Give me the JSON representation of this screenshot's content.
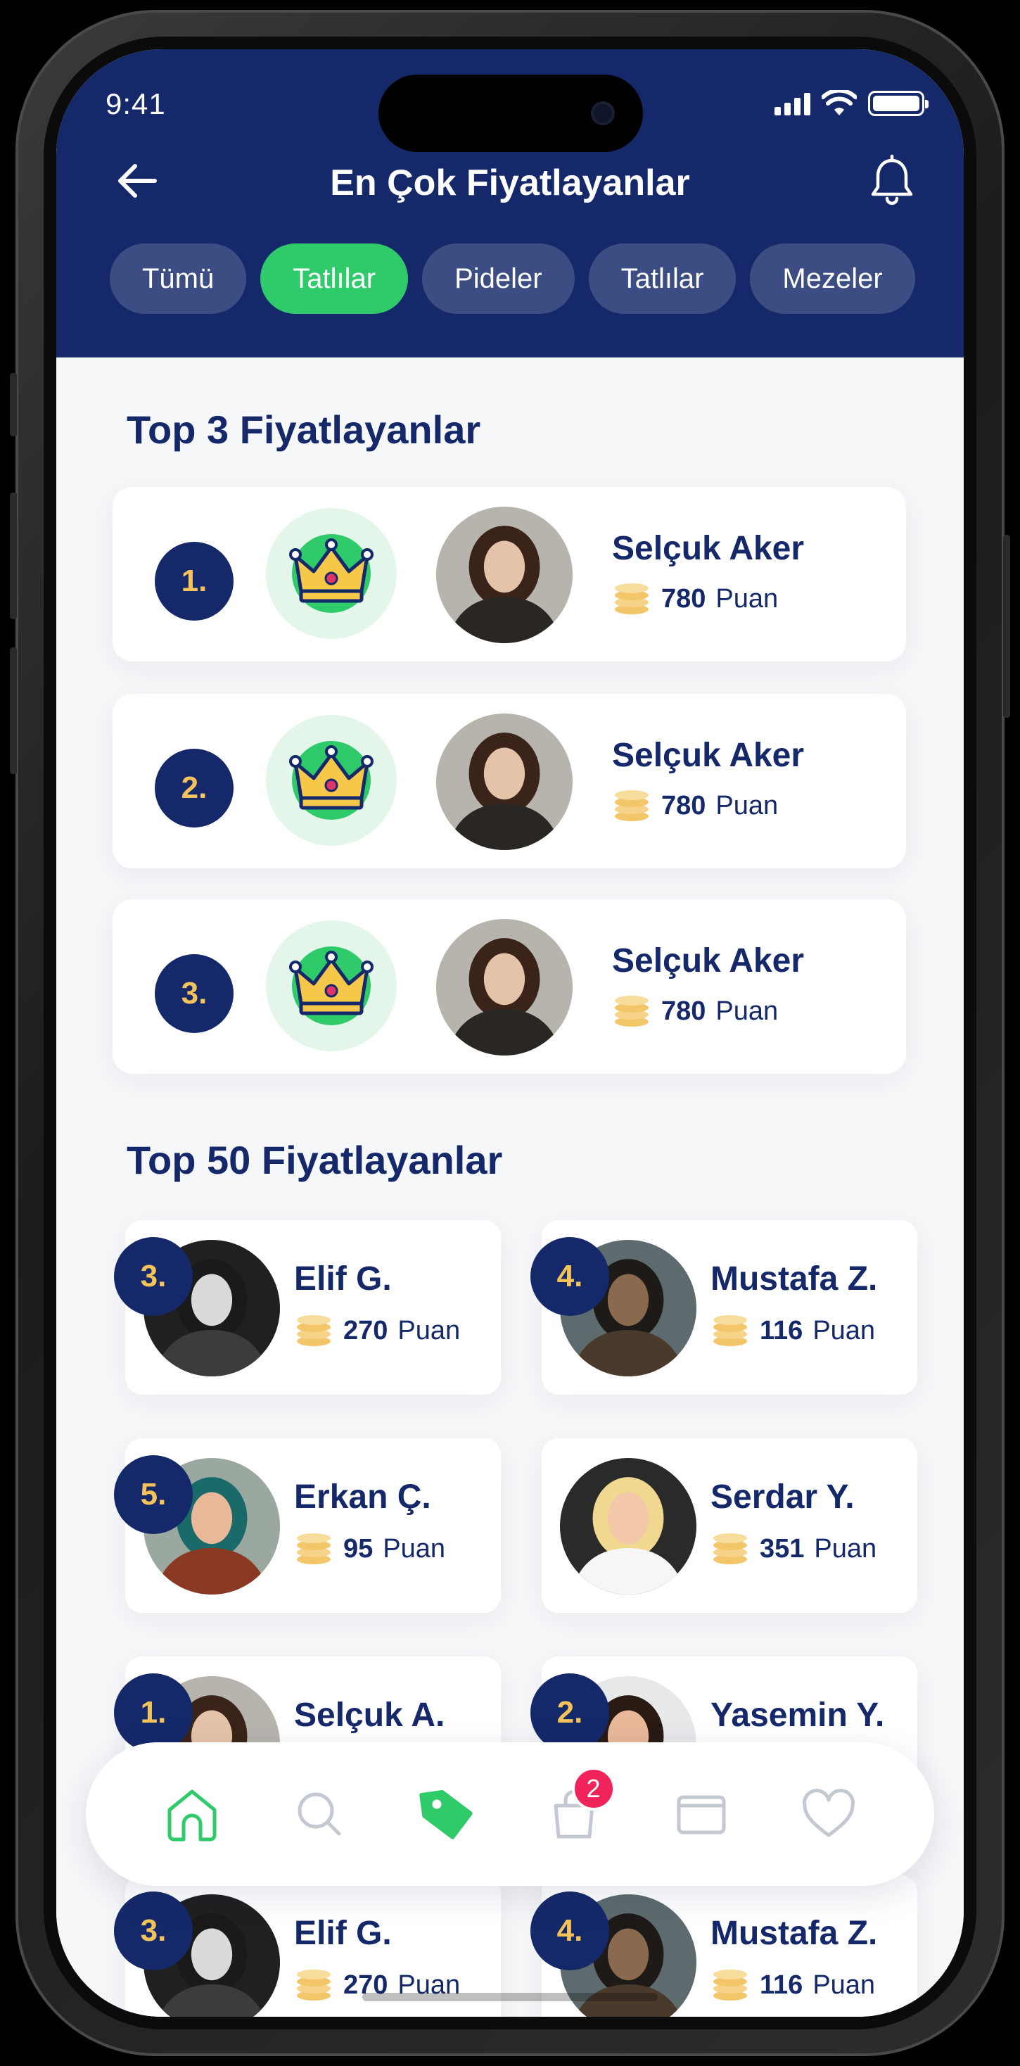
{
  "status": {
    "time": "9:41"
  },
  "header": {
    "title": "En Çok Fiyatlayanlar"
  },
  "chips": [
    {
      "label": "Tümü",
      "active": false
    },
    {
      "label": "Tatlılar",
      "active": true
    },
    {
      "label": "Pideler",
      "active": false
    },
    {
      "label": "Tatlılar",
      "active": false
    },
    {
      "label": "Mezeler",
      "active": false
    }
  ],
  "top3": {
    "title": "Top 3 Fiyatlayanlar",
    "items": [
      {
        "rank": "1.",
        "name": "Selçuk Aker",
        "points": "780",
        "unit": "Puan"
      },
      {
        "rank": "2.",
        "name": "Selçuk Aker",
        "points": "780",
        "unit": "Puan"
      },
      {
        "rank": "3.",
        "name": "Selçuk Aker",
        "points": "780",
        "unit": "Puan"
      }
    ]
  },
  "top50": {
    "title": "Top 50 Fiyatlayanlar",
    "items": [
      {
        "rank": "3.",
        "name": "Elif G.",
        "points": "270",
        "unit": "Puan"
      },
      {
        "rank": "4.",
        "name": "Mustafa Z.",
        "points": "116",
        "unit": "Puan"
      },
      {
        "rank": "5.",
        "name": "Erkan Ç.",
        "points": "95",
        "unit": "Puan"
      },
      {
        "rank": "",
        "name": "Serdar Y.",
        "points": "351",
        "unit": "Puan"
      },
      {
        "rank": "1.",
        "name": "Selçuk A.",
        "points": "",
        "unit": ""
      },
      {
        "rank": "2.",
        "name": "Yasemin Y.",
        "points": "",
        "unit": ""
      },
      {
        "rank": "3.",
        "name": "Elif G.",
        "points": "270",
        "unit": "Puan"
      },
      {
        "rank": "4.",
        "name": "Mustafa Z.",
        "points": "116",
        "unit": "Puan"
      }
    ]
  },
  "nav": {
    "cart_badge": "2"
  },
  "colors": {
    "navy": "#15296a",
    "green": "#2fca6a",
    "gold": "#f4c45a",
    "badge": "#f0245a"
  }
}
